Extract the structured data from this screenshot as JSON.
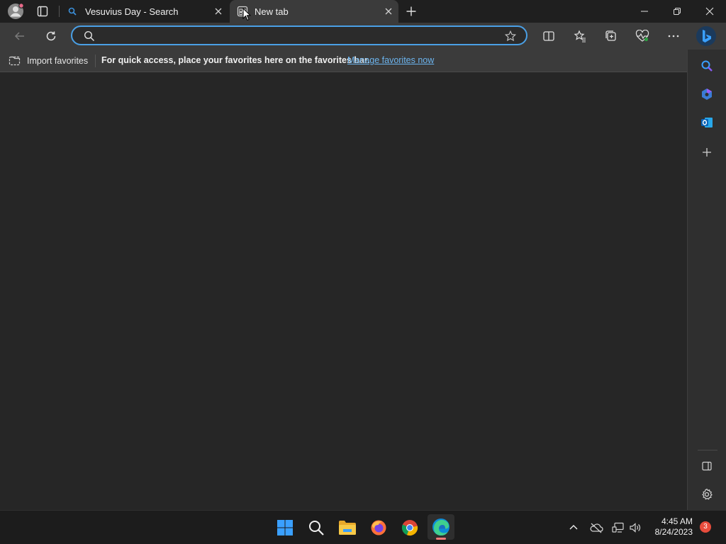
{
  "tabs": [
    {
      "title": "Vesuvius Day - Search",
      "icon": "search-icon",
      "active": false
    },
    {
      "title": "New tab",
      "icon": "new-tab-page-icon",
      "active": true
    }
  ],
  "address_bar": {
    "value": "",
    "placeholder": ""
  },
  "favorites_bar": {
    "import_label": "Import favorites",
    "message": "For quick access, place your favorites here on the favorites bar.",
    "manage_link": "Manage favorites now"
  },
  "taskbar": {
    "time": "4:45 AM",
    "date": "8/24/2023",
    "notification_count": "3"
  },
  "colors": {
    "accent": "#4aa0e6",
    "link": "#6cb4ee",
    "badge": "#e74c3c"
  }
}
